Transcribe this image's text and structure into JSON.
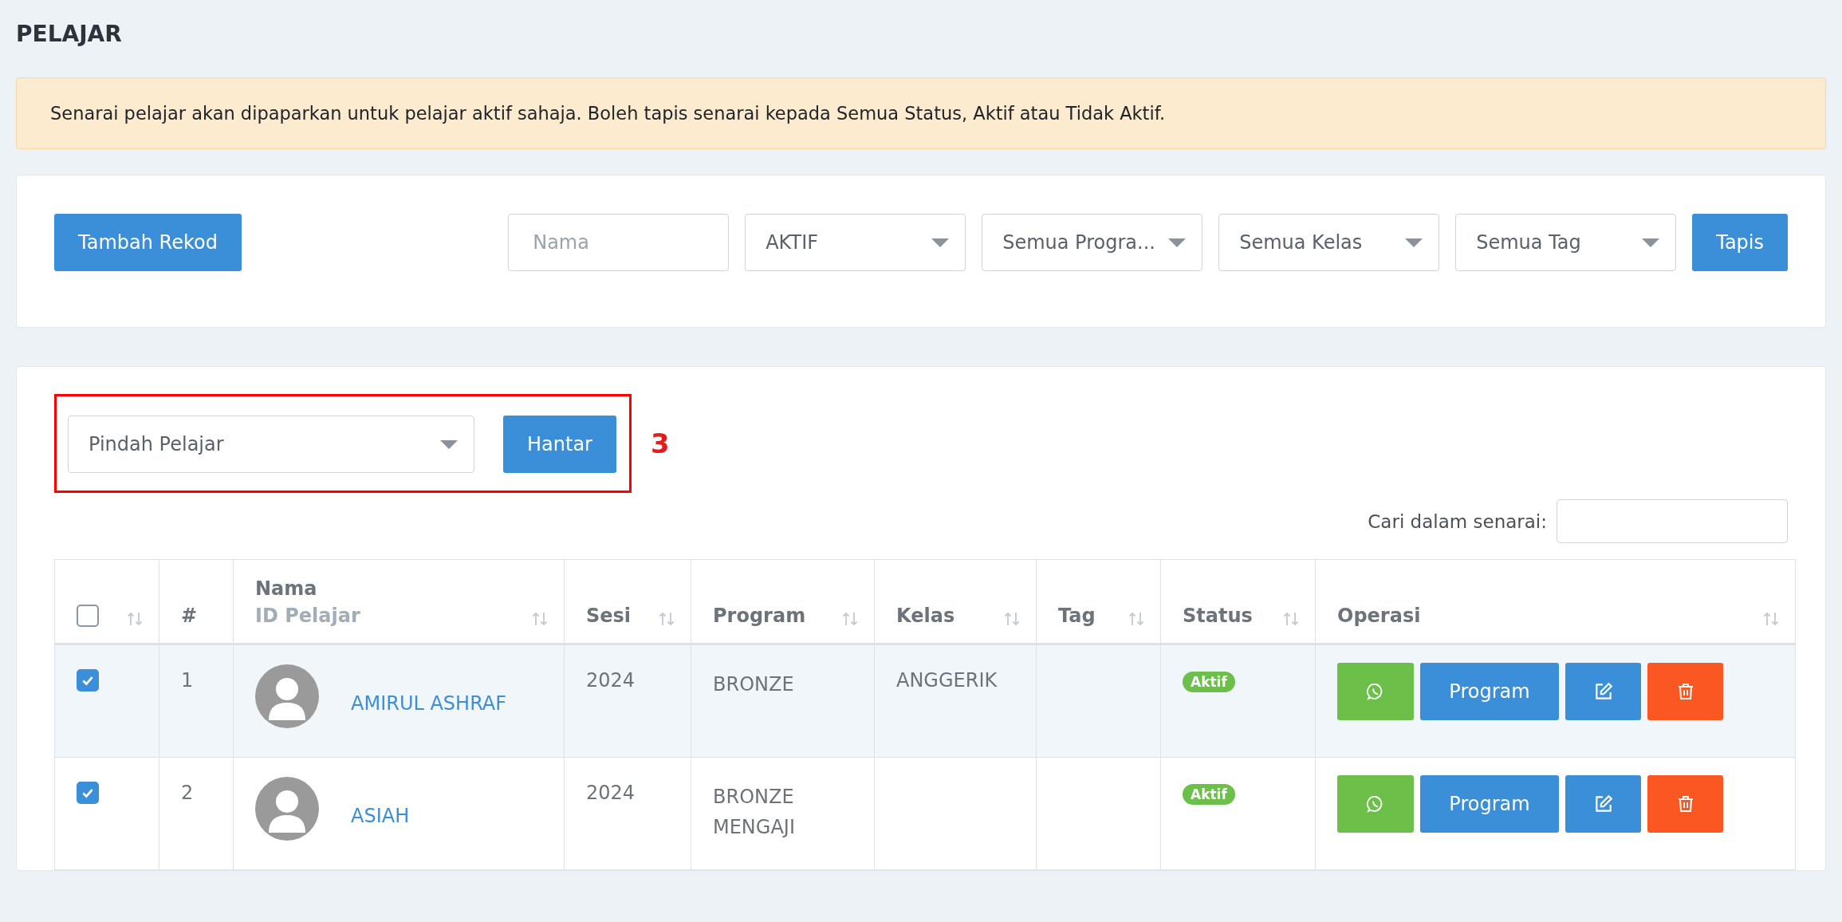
{
  "page": {
    "title": "PELAJAR"
  },
  "notice": {
    "text": "Senarai pelajar akan dipaparkan untuk pelajar aktif sahaja. Boleh tapis senarai kepada Semua Status, Aktif atau Tidak Aktif."
  },
  "filters": {
    "add_button": "Tambah Rekod",
    "name_field": {
      "placeholder": "Nama"
    },
    "dropdowns": [
      {
        "value": "AKTIF"
      },
      {
        "value": "Semua Progra..."
      },
      {
        "value": "Semua Kelas"
      },
      {
        "value": "Semua Tag"
      }
    ],
    "filter_button": "Tapis"
  },
  "bulk_action": {
    "dropdown": {
      "value": "Pindah Pelajar"
    },
    "submit_button": "Hantar",
    "annotation": {
      "label": "3"
    }
  },
  "search": {
    "label": "Cari dalam senarai:"
  },
  "table": {
    "columns": [
      {
        "kind": "select",
        "checked": false,
        "sortable": true
      },
      {
        "kind": "text",
        "label": "#",
        "sortable": false
      },
      {
        "kind": "text",
        "label": "Nama",
        "sublabel": "ID Pelajar",
        "sortable": true
      },
      {
        "kind": "text",
        "label": "Sesi",
        "sortable": true
      },
      {
        "kind": "text",
        "label": "Program",
        "sortable": true
      },
      {
        "kind": "text",
        "label": "Kelas",
        "sortable": true
      },
      {
        "kind": "text",
        "label": "Tag",
        "sortable": true
      },
      {
        "kind": "text",
        "label": "Status",
        "sortable": true
      },
      {
        "kind": "text",
        "label": "Operasi",
        "sortable": true
      }
    ],
    "rows": [
      {
        "checked": true,
        "highlighted": true,
        "index": "1",
        "name": "AMIRUL ASHRAF",
        "session": "2024",
        "program": "BRONZE",
        "class": "ANGGERIK",
        "status": "Aktif",
        "program_button": "Program"
      },
      {
        "checked": true,
        "highlighted": false,
        "index": "2",
        "name": "ASIAH",
        "session": "2024",
        "program": "BRONZE MENGAJI",
        "status": "Aktif",
        "program_button": "Program"
      }
    ]
  }
}
